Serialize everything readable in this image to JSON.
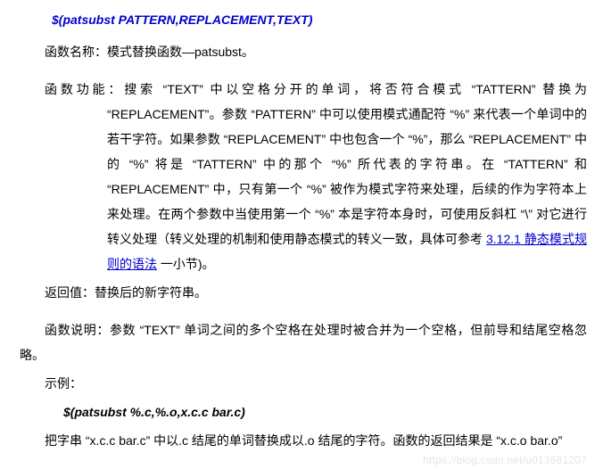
{
  "title": "$(patsubst PATTERN,REPLACEMENT,TEXT)",
  "fn_name": "函数名称：模式替换函数—patsubst。",
  "fn_func": "函数功能：搜索 “TEXT” 中以空格分开的单词，将否符合模式 “TATTERN” 替换为 “REPLACEMENT”。参数 “PATTERN” 中可以使用模式通配符 “%” 来代表一个单词中的若干字符。如果参数 “REPLACEMENT” 中也包含一个 “%”，那么 “REPLACEMENT” 中的 “%” 将是 “TATTERN” 中的那个 “%” 所代表的字符串。在 “TATTERN” 和 “REPLACEMENT” 中，只有第一个 “%” 被作为模式字符来处理，后续的作为字符本上来处理。在两个参数中当使用第一个 “%” 本是字符本身时，可使用反斜杠 “\\” 对它进行转义处理（转义处理的机制和使用静态模式的转义一致，具体可参考 ",
  "link_text": "3.12.1  静态模式规则的语法",
  "fn_func_tail": "  一小节)。",
  "ret": "返回值：替换后的新字符串。",
  "desc": "函数说明：参数 “TEXT” 单词之间的多个空格在处理时被合并为一个空格，但前导和结尾空格忽略。",
  "example_label": "示例：",
  "example_code": "$(patsubst %.c,%.o,x.c.c bar.c)",
  "result": "把字串 “x.c.c bar.c” 中以.c 结尾的单词替换成以.o 结尾的字符。函数的返回结果是 “x.c.o bar.o”",
  "watermark": "https://blog.csdn.net/u013581207"
}
